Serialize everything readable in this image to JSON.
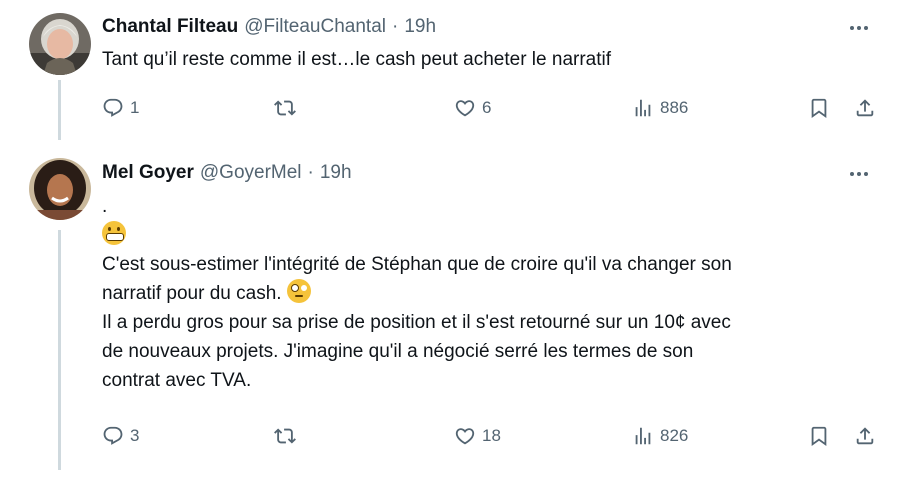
{
  "tweets": [
    {
      "name": "Chantal Filteau",
      "handle": "@FilteauChantal",
      "separator": "·",
      "time": "19h",
      "lines": [
        "Tant qu’il reste comme il est…le cash peut acheter le narratif"
      ],
      "replies": "1",
      "retweets": "",
      "likes": "6",
      "views": "886"
    },
    {
      "name": "Mel Goyer",
      "handle": "@GoyerMel",
      "separator": "·",
      "time": "19h",
      "line1": ".",
      "line3": "C'est sous-estimer l'intégrité de Stéphan que de croire qu'il va changer son",
      "line4": "narratif pour du cash.",
      "line5": "Il a perdu gros pour sa prise de position et il s'est retourné sur un 10¢ avec",
      "line6": "de nouveaux projets. J'imagine qu'il a négocié serré les termes de son",
      "line7": "contrat avec TVA.",
      "replies": "3",
      "retweets": "",
      "likes": "18",
      "views": "826"
    }
  ],
  "icons": {
    "reply": "speech-bubble-icon",
    "retweet": "retweet-arrows-icon",
    "like": "heart-icon",
    "views": "bar-chart-icon",
    "bookmark": "bookmark-icon",
    "share": "share-upload-icon",
    "more": "ellipsis-icon",
    "emoji1": "grimacing-face-emoji",
    "emoji2": "face-with-rolling-eyes-emoji"
  },
  "colors": {
    "text": "#0f1419",
    "secondary": "#536471",
    "thread_line": "#cfd9de"
  }
}
